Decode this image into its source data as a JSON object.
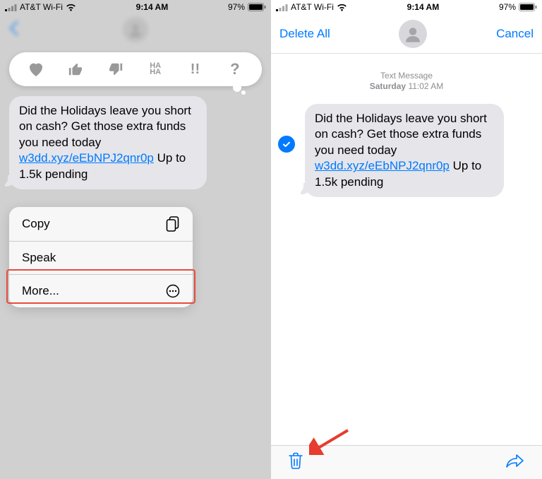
{
  "status": {
    "carrier": "AT&T Wi-Fi",
    "time": "9:14 AM",
    "battery": "97%"
  },
  "reactions": {
    "haha": "HA\nHA",
    "exclaim": "!!",
    "question": "?"
  },
  "message": {
    "text_before_link": "Did the Holidays leave you short on cash? Get those extra funds you need today ",
    "link": "w3dd.xyz/eEbNPJ2qnr0p",
    "text_after_link": " Up to 1.5k pending"
  },
  "menu": {
    "copy": "Copy",
    "speak": "Speak",
    "more": "More..."
  },
  "right_nav": {
    "delete_all": "Delete All",
    "cancel": "Cancel"
  },
  "chat_header": {
    "label": "Text Message",
    "day": "Saturday",
    "time": "11:02 AM"
  }
}
